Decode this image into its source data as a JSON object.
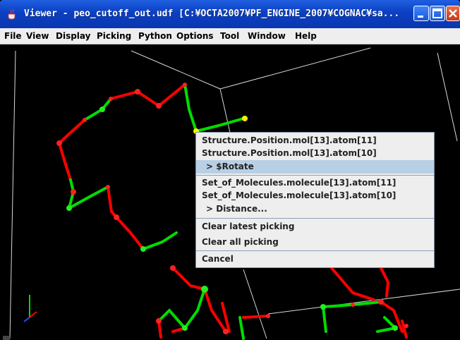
{
  "window": {
    "title": "Viewer - peo_cutoff_out.udf [C:¥OCTA2007¥PF_ENGINE_2007¥COGNAC¥sa...",
    "icon": "java-cup-icon",
    "controls": [
      "minimize-icon",
      "maximize-icon",
      "close-icon"
    ]
  },
  "menubar": {
    "file": "File",
    "view": "View",
    "display": "Display",
    "picking": "Picking",
    "python": "Python",
    "options": "Options",
    "tool": "Tool",
    "window": "Window",
    "help": "Help"
  },
  "context_menu": {
    "items": [
      "Structure.Position.mol[13].atom[11]",
      "Structure.Position.mol[13].atom[10]",
      "> $Rotate",
      "Set_of_Molecules.molecule[13].atom[11]",
      "Set_of_Molecules.molecule[13].atom[10]",
      "> Distance...",
      "Clear latest picking",
      "Clear all picking",
      "Cancel"
    ],
    "selected_index": 2
  },
  "viewport": {
    "background": "#000000",
    "bond_colors": [
      "#ff0000",
      "#00dd00"
    ],
    "picked_atom_color": "#ffee00",
    "axes_icon": "xyz-axes-icon"
  }
}
